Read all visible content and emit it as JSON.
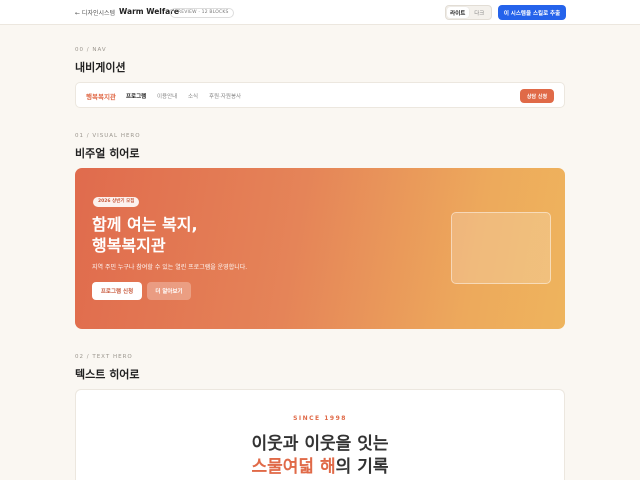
{
  "topbar": {
    "back_label": "← 디자인시스템",
    "title": "Warm Welfare",
    "preview_badge": "PREVIEW · 12 BLOCKS",
    "theme_light": "라이트",
    "theme_dark": "다크",
    "export_label": "이 시스템을 스킬로 추출",
    "accent_color": "#2563eb"
  },
  "sections": {
    "nav": {
      "label": "00 / NAV",
      "title": "내비게이션"
    },
    "visual_hero": {
      "label": "01 / VISUAL HERO",
      "title": "비주얼 히어로"
    },
    "text_hero": {
      "label": "02 / TEXT HERO",
      "title": "텍스트 히어로"
    }
  },
  "nav_preview": {
    "logo": "행복복지관",
    "items": [
      "프로그램",
      "이용안내",
      "소식",
      "후원·자원봉사"
    ],
    "cta": "상담 신청",
    "brand_color": "#e06a48"
  },
  "visual_hero": {
    "badge": "2026 상반기 모집",
    "title_line1": "함께 여는 복지,",
    "title_line2": "행복복지관",
    "description": "지역 주민 누구나 참여할 수 있는 열린 프로그램을 운영합니다.",
    "primary_button": "프로그램 신청",
    "secondary_button": "더 알아보기"
  },
  "text_hero": {
    "eyebrow": "SINCE 1998",
    "line1": "이웃과 이웃을 잇는",
    "line2_accent1": "스물여덟",
    "line2_space": " ",
    "line2_accent2": "해",
    "line2_rest": "의 기록"
  }
}
